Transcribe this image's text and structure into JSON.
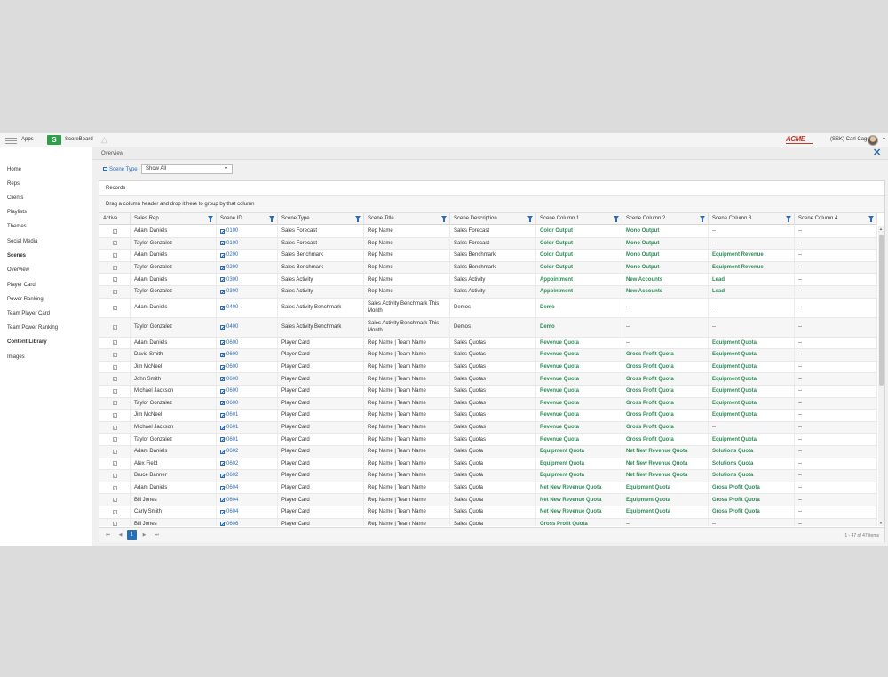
{
  "topbar": {
    "apps_label": "Apps",
    "scoreboard_logo": "S",
    "scoreboard_label": "ScoreBoard",
    "brand_logo": "ACME",
    "user_label": "(SSK) Carl Cage"
  },
  "sidebar": {
    "items": [
      {
        "label": "Home",
        "bold": false
      },
      {
        "label": "Reps",
        "bold": false
      },
      {
        "label": "Clients",
        "bold": false
      },
      {
        "label": "Playlists",
        "bold": false
      },
      {
        "label": "Themes",
        "bold": false
      },
      {
        "label": "Social Media",
        "bold": false
      },
      {
        "label": "Scenes",
        "bold": true
      },
      {
        "label": "Overview",
        "bold": false
      },
      {
        "label": "Player Card",
        "bold": false
      },
      {
        "label": "Power Ranking",
        "bold": false
      },
      {
        "label": "Team Player Card",
        "bold": false
      },
      {
        "label": "Team Power Ranking",
        "bold": false
      },
      {
        "label": "Content Library",
        "bold": true
      },
      {
        "label": "Images",
        "bold": false
      }
    ]
  },
  "main": {
    "breadcrumb": "Overview",
    "filter_label": "Scene Type",
    "filter_value": "Show All"
  },
  "records": {
    "title": "Records",
    "group_hint": "Drag a column header and drop it here to group by that column",
    "columns": [
      "Active",
      "Sales Rep",
      "Scene ID",
      "Scene Type",
      "Scene Title",
      "Scene Description",
      "Scene Column 1",
      "Scene Column 2",
      "Scene Column 3",
      "Scene Column 4"
    ],
    "rows": [
      [
        "Adam Daniels",
        "0100",
        "Sales Forecast",
        "Rep Name",
        "Sales Forecast",
        "Color Output",
        "Mono Output",
        "--",
        "--"
      ],
      [
        "Taylor Gonzalez",
        "0100",
        "Sales Forecast",
        "Rep Name",
        "Sales Forecast",
        "Color Output",
        "Mono Output",
        "--",
        "--"
      ],
      [
        "Adam Daniels",
        "0200",
        "Sales Benchmark",
        "Rep Name",
        "Sales Benchmark",
        "Color Output",
        "Mono Output",
        "Equipment Revenue",
        "--"
      ],
      [
        "Taylor Gonzalez",
        "0200",
        "Sales Benchmark",
        "Rep Name",
        "Sales Benchmark",
        "Color Output",
        "Mono Output",
        "Equipment Revenue",
        "--"
      ],
      [
        "Adam Daniels",
        "0300",
        "Sales Activity",
        "Rep Name",
        "Sales Activity",
        "Appointment",
        "New Accounts",
        "Lead",
        "--"
      ],
      [
        "Taylor Gonzalez",
        "0300",
        "Sales Activity",
        "Rep Name",
        "Sales Activity",
        "Appointment",
        "New Accounts",
        "Lead",
        "--"
      ],
      [
        "Adam Daniels",
        "0400",
        "Sales Activity Benchmark",
        "Sales Activity Benchmark This Month",
        "Demos",
        "Demo",
        "--",
        "--",
        "--"
      ],
      [
        "Taylor Gonzalez",
        "0400",
        "Sales Activity Benchmark",
        "Sales Activity Benchmark This Month",
        "Demos",
        "Demo",
        "--",
        "--",
        "--"
      ],
      [
        "Adam Daniels",
        "0600",
        "Player Card",
        "Rep Name | Team Name",
        "Sales Quotas",
        "Revenue Quota",
        "--",
        "Equipment Quota",
        "--"
      ],
      [
        "David Smith",
        "0600",
        "Player Card",
        "Rep Name | Team Name",
        "Sales Quotas",
        "Revenue Quota",
        "Gross Profit Quota",
        "Equipment Quota",
        "--"
      ],
      [
        "Jim McNeel",
        "0600",
        "Player Card",
        "Rep Name | Team Name",
        "Sales Quotas",
        "Revenue Quota",
        "Gross Profit Quota",
        "Equipment Quota",
        "--"
      ],
      [
        "John Smith",
        "0600",
        "Player Card",
        "Rep Name | Team Name",
        "Sales Quotas",
        "Revenue Quota",
        "Gross Profit Quota",
        "Equipment Quota",
        "--"
      ],
      [
        "Michael Jackson",
        "0600",
        "Player Card",
        "Rep Name | Team Name",
        "Sales Quotas",
        "Revenue Quota",
        "Gross Profit Quota",
        "Equipment Quota",
        "--"
      ],
      [
        "Taylor Gonzalez",
        "0600",
        "Player Card",
        "Rep Name | Team Name",
        "Sales Quotas",
        "Revenue Quota",
        "Gross Profit Quota",
        "Equipment Quota",
        "--"
      ],
      [
        "Jim McNeel",
        "0601",
        "Player Card",
        "Rep Name | Team Name",
        "Sales Quotas",
        "Revenue Quota",
        "Gross Profit Quota",
        "Equipment Quota",
        "--"
      ],
      [
        "Michael Jackson",
        "0601",
        "Player Card",
        "Rep Name | Team Name",
        "Sales Quotas",
        "Revenue Quota",
        "Gross Profit Quota",
        "--",
        "--"
      ],
      [
        "Taylor Gonzalez",
        "0601",
        "Player Card",
        "Rep Name | Team Name",
        "Sales Quotas",
        "Revenue Quota",
        "Gross Profit Quota",
        "Equipment Quota",
        "--"
      ],
      [
        "Adam Daniels",
        "0602",
        "Player Card",
        "Rep Name | Team Name",
        "Sales Quota",
        "Equipment Quota",
        "Net New Revenue Quota",
        "Solutions Quota",
        "--"
      ],
      [
        "Alex Field",
        "0602",
        "Player Card",
        "Rep Name | Team Name",
        "Sales Quota",
        "Equipment Quota",
        "Net New Revenue Quota",
        "Solutions Quota",
        "--"
      ],
      [
        "Bruce Banner",
        "0602",
        "Player Card",
        "Rep Name | Team Name",
        "Sales Quota",
        "Equipment Quota",
        "Net New Revenue Quota",
        "Solutions Quota",
        "--"
      ],
      [
        "Adam Daniels",
        "0604",
        "Player Card",
        "Rep Name | Team Name",
        "Sales Quota",
        "Net New Revenue Quota",
        "Equipment Quota",
        "Gross Profit Quota",
        "--"
      ],
      [
        "Bill Jones",
        "0604",
        "Player Card",
        "Rep Name | Team Name",
        "Sales Quota",
        "Net New Revenue Quota",
        "Equipment Quota",
        "Gross Profit Quota",
        "--"
      ],
      [
        "Carly Smith",
        "0604",
        "Player Card",
        "Rep Name | Team Name",
        "Sales Quota",
        "Net New Revenue Quota",
        "Equipment Quota",
        "Gross Profit Quota",
        "--"
      ],
      [
        "Bill Jones",
        "0606",
        "Player Card",
        "Rep Name | Team Name",
        "Sales Quota",
        "Gross Profit Quota",
        "--",
        "--",
        "--"
      ]
    ]
  },
  "pager": {
    "first": "⏮",
    "prev": "◀",
    "current_page": "1",
    "next": "▶",
    "last": "⏭",
    "info": "1 - 47 of 47 items"
  },
  "colors": {
    "accent": "#2a6db5",
    "positive_text": "#2e8b57",
    "scoreboard_green": "#2e9e49",
    "brand_red": "#c0392b"
  }
}
